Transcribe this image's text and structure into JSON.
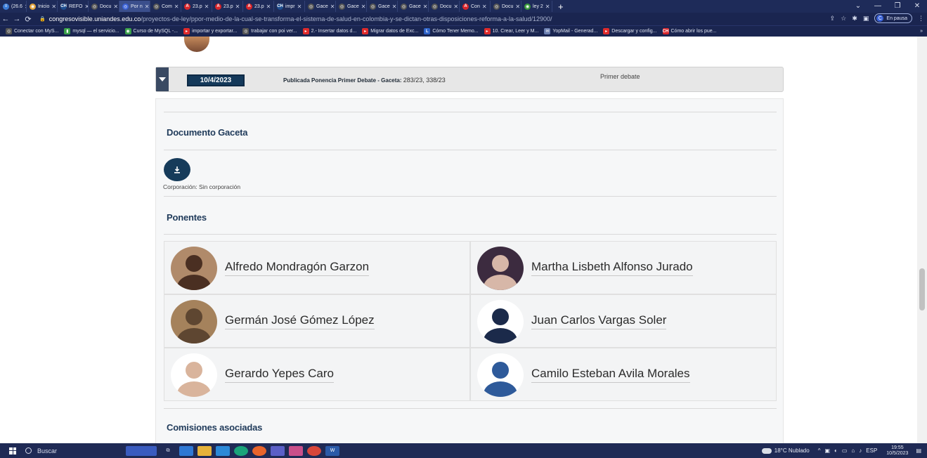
{
  "browser": {
    "tabs": [
      {
        "label": "(26.6",
        "icon_color": "#3a7bd5",
        "icon_glyph": "≡"
      },
      {
        "label": "Inicio",
        "icon_color": "#e2a23b",
        "icon_glyph": "◉"
      },
      {
        "label": "REFO",
        "icon_color": "#1d4d8f",
        "icon_glyph": "CH"
      },
      {
        "label": "Docu",
        "icon_color": "#555",
        "icon_glyph": "◎"
      },
      {
        "label": "Por n",
        "icon_color": "#3b62d6",
        "icon_glyph": "◎",
        "active": true
      },
      {
        "label": "Com",
        "icon_color": "#555",
        "icon_glyph": "◎"
      },
      {
        "label": "23.p",
        "icon_color": "#d9252a",
        "icon_glyph": "A"
      },
      {
        "label": "23.p",
        "icon_color": "#d9252a",
        "icon_glyph": "A"
      },
      {
        "label": "23.p",
        "icon_color": "#d9252a",
        "icon_glyph": "A"
      },
      {
        "label": "impr",
        "icon_color": "#1d4d8f",
        "icon_glyph": "CH"
      },
      {
        "label": "Gace",
        "icon_color": "#555",
        "icon_glyph": "◎"
      },
      {
        "label": "Gace",
        "icon_color": "#555",
        "icon_glyph": "◎"
      },
      {
        "label": "Gace",
        "icon_color": "#555",
        "icon_glyph": "◎"
      },
      {
        "label": "Gace",
        "icon_color": "#555",
        "icon_glyph": "◎"
      },
      {
        "label": "Docu",
        "icon_color": "#555",
        "icon_glyph": "◎"
      },
      {
        "label": "Con",
        "icon_color": "#d9252a",
        "icon_glyph": "A"
      },
      {
        "label": "Docu",
        "icon_color": "#555",
        "icon_glyph": "◎"
      },
      {
        "label": "ley 2",
        "icon_color": "#3a9a3a",
        "icon_glyph": "◉"
      }
    ],
    "url_domain": "congresovisible.uniandes.edu.co",
    "url_path": "/proyectos-de-ley/ppor-medio-de-la-cual-se-transforma-el-sistema-de-salud-en-colombia-y-se-dictan-otras-disposiciones-reforma-a-la-salud/12900/",
    "profile_letter": "C",
    "profile_status": "En pausa",
    "bookmarks": [
      {
        "label": "Conectar con MyS...",
        "icon_color": "#555",
        "icon_glyph": "◎"
      },
      {
        "label": "mysql — el servicio...",
        "icon_color": "#3aa14a",
        "icon_glyph": "▮"
      },
      {
        "label": "Curso de MySQL -...",
        "icon_color": "#3aa14a",
        "icon_glyph": "◉"
      },
      {
        "label": "importar y exportar...",
        "icon_color": "#e02b2b",
        "icon_glyph": "▸"
      },
      {
        "label": "trabajar con poi ver...",
        "icon_color": "#555",
        "icon_glyph": "◎"
      },
      {
        "label": "2.- Insertar datos d...",
        "icon_color": "#e02b2b",
        "icon_glyph": "▸"
      },
      {
        "label": "Migrar datos de Exc...",
        "icon_color": "#e02b2b",
        "icon_glyph": "▸"
      },
      {
        "label": "Cómo Tener Memo...",
        "icon_color": "#2e63c9",
        "icon_glyph": "L"
      },
      {
        "label": "10. Crear, Leer y M...",
        "icon_color": "#e02b2b",
        "icon_glyph": "▸"
      },
      {
        "label": "YopMail - Generad...",
        "icon_color": "#6b7fb0",
        "icon_glyph": "✉"
      },
      {
        "label": "Descargar y config...",
        "icon_color": "#e02b2b",
        "icon_glyph": "▸"
      },
      {
        "label": "Cómo abrir los pue...",
        "icon_color": "#d9252a",
        "icon_glyph": "CH"
      }
    ]
  },
  "debate": {
    "date": "10/4/2023",
    "publication_label": "Publicada Ponencia Primer Debate - Gaceta:",
    "publication_value": "283/23, 338/23",
    "stage": "Primer debate"
  },
  "documento": {
    "title": "Documento Gaceta",
    "corporacion": "Corporación: Sin corporación"
  },
  "ponentes": {
    "title": "Ponentes",
    "items": [
      {
        "name": "Alfredo Mondragón Garzon",
        "avatar_bg": "#b08a6a",
        "avatar_fg": "#4a2f22"
      },
      {
        "name": "Martha Lisbeth Alfonso Jurado",
        "avatar_bg": "#3c2b3f",
        "avatar_fg": "#d7b7a8"
      },
      {
        "name": "Germán José Gómez López",
        "avatar_bg": "#a5825c",
        "avatar_fg": "#5e4631"
      },
      {
        "name": "Juan Carlos Vargas Soler",
        "avatar_bg": "#ffffff",
        "avatar_fg": "#1b2a4a"
      },
      {
        "name": "Gerardo Yepes Caro",
        "avatar_bg": "#ffffff",
        "avatar_fg": "#d9b49c"
      },
      {
        "name": "Camilo Esteban Avila Morales",
        "avatar_bg": "#ffffff",
        "avatar_fg": "#2e5a9a"
      }
    ]
  },
  "comisiones": {
    "title": "Comisiones asociadas"
  },
  "taskbar": {
    "search_placeholder": "Buscar",
    "weather": "18°C Nublado",
    "language": "ESP",
    "time": "19:55",
    "date": "10/5/2023"
  }
}
